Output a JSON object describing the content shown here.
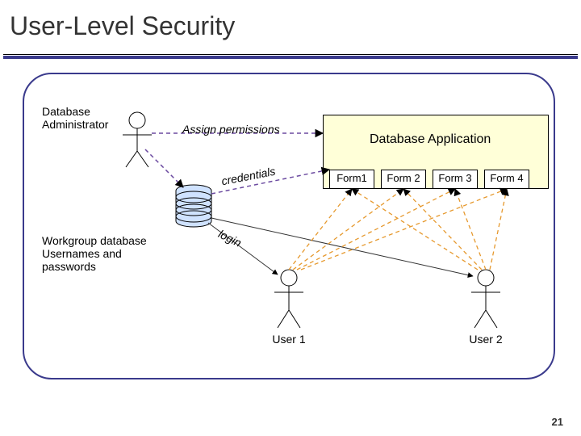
{
  "slide": {
    "title": "User-Level Security",
    "page_number": "21"
  },
  "actors": {
    "dba_label_l1": "Database",
    "dba_label_l2": "Administrator",
    "user1_label": "User 1",
    "user2_label": "User 2"
  },
  "workgroup": {
    "label_l1": "Workgroup database",
    "label_l2": "Usernames and",
    "label_l3": "passwords"
  },
  "app": {
    "title": "Database Application",
    "forms": [
      "Form1",
      "Form 2",
      "Form 3",
      "Form 4"
    ]
  },
  "edges": {
    "assign_permissions": "Assign permissions",
    "credentials": "credentials",
    "login": "login"
  }
}
